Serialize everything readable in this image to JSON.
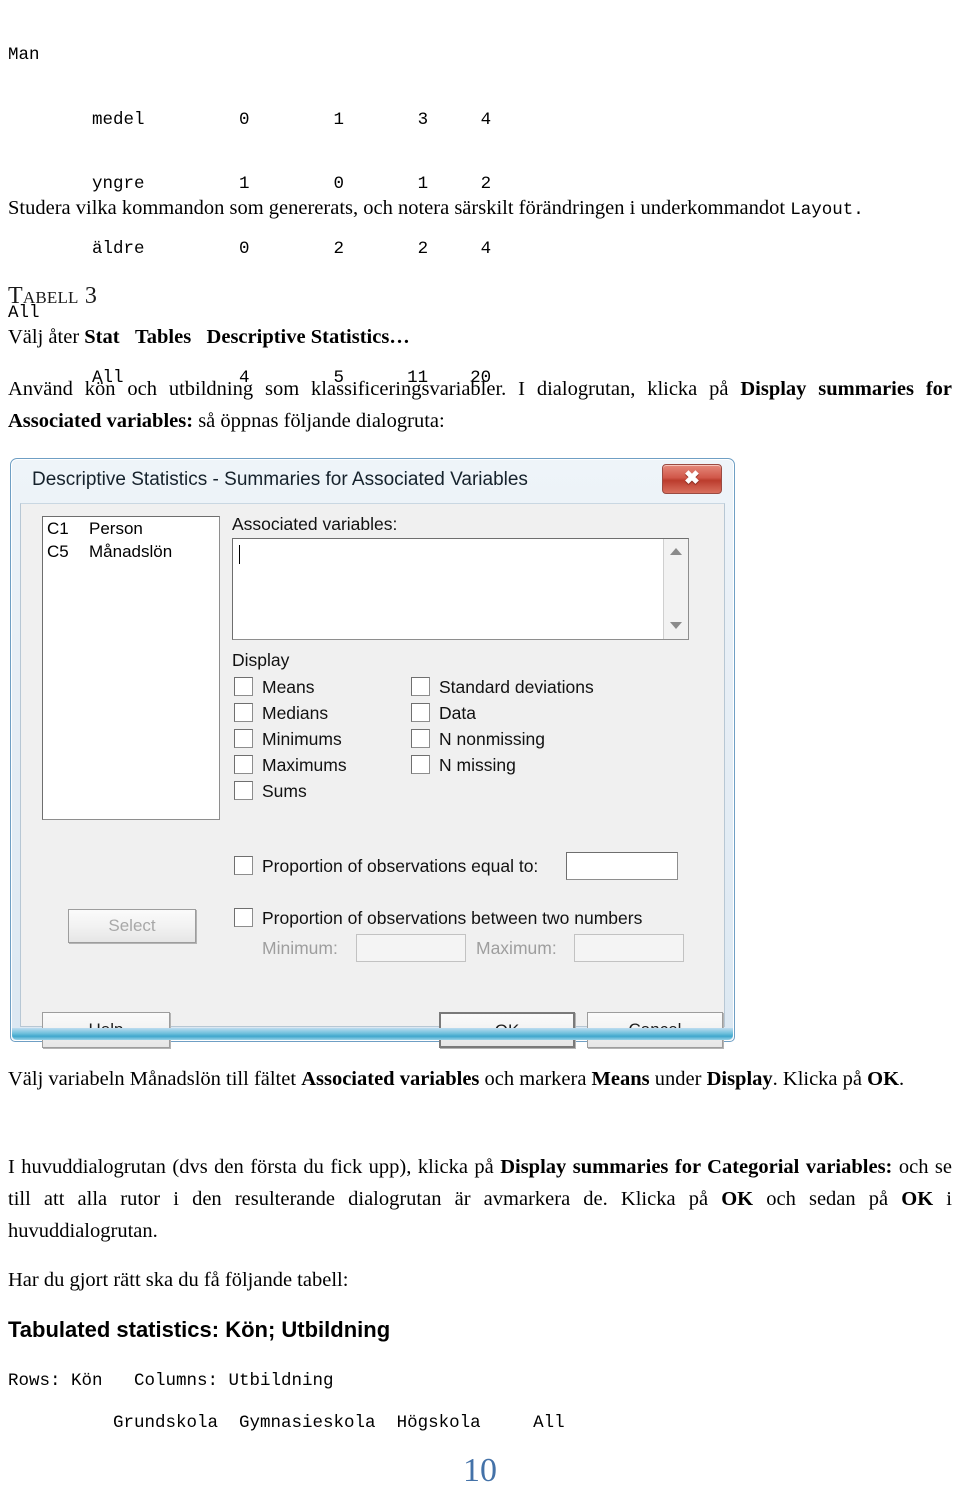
{
  "top_output": {
    "lines": [
      "Man",
      "        medel         0        1       3     4",
      "        yngre         1        0       1     2",
      "        äldre         0        2       2     4",
      "All",
      "        All           4        5      11    20"
    ]
  },
  "paragraphs": {
    "p1_a": "Studera vilka kommandon som genererats, och notera särskilt förändringen i underkommandot ",
    "p1_code": "Layout.",
    "tabell_heading_sc": "Tabell",
    "tabell_heading_num": " 3",
    "p2_a": "Välj åter ",
    "p2_b1": "Stat",
    "p2_b2": "Tables",
    "p2_b3": "Descriptive Statistics…",
    "p3_a": "Använd kön och utbildning som klassificeringsvariabler. I dialogrutan, klicka på ",
    "p3_b1": "Display summaries for Associated variables:",
    "p3_c": " så öppnas följande dialogruta:",
    "p4_a": "Välj variabeln Månadslön till fältet ",
    "p4_b1": "Associated variables",
    "p4_b": " och markera ",
    "p4_b2": "Means",
    "p4_c": " under ",
    "p4_b3": "Display",
    "p4_d": ". Klicka på ",
    "p4_b4": "OK",
    "p4_e": ".",
    "p5_a": "I huvuddialogrutan (dvs den första du fick upp), klicka på ",
    "p5_b1": "Display summaries for Categorial variables:",
    "p5_b": "  och se till att alla rutor i den resulterande dialogrutan är avmarkera de. Klicka på ",
    "p5_b2": "OK",
    "p5_c": " och sedan på ",
    "p5_b3": "OK",
    "p5_d": " i huvuddialogrutan.",
    "p6": "Har du gjort rätt ska du få följande tabell:"
  },
  "dialog": {
    "title": "Descriptive Statistics - Summaries for Associated Variables",
    "close_glyph": "✖",
    "variables": [
      {
        "code": "C1",
        "name": "Person"
      },
      {
        "code": "C5",
        "name": "Månadslön"
      }
    ],
    "select_button": "Select",
    "help_button": "Help",
    "ok_button": "OK",
    "cancel_button": "Cancel",
    "associated_label": "Associated variables:",
    "associated_value": "",
    "display_label": "Display",
    "checkboxes_left": [
      {
        "label": "Means",
        "checked": false
      },
      {
        "label": "Medians",
        "checked": false
      },
      {
        "label": "Minimums",
        "checked": false
      },
      {
        "label": "Maximums",
        "checked": false
      },
      {
        "label": "Sums",
        "checked": false
      }
    ],
    "checkboxes_right": [
      {
        "label": "Standard deviations",
        "checked": false
      },
      {
        "label": "Data",
        "checked": false
      },
      {
        "label": "N nonmissing",
        "checked": false
      },
      {
        "label": "N missing",
        "checked": false
      }
    ],
    "prop_equal_label": "Proportion of observations equal to:",
    "prop_equal_value": "",
    "prop_between_label": "Proportion of observations between two numbers",
    "minimum_label": "Minimum:",
    "minimum_value": "",
    "maximum_label": "Maximum:",
    "maximum_value": ""
  },
  "bottom_output": {
    "tabulated_heading": "Tabulated statistics: Kön; Utbildning",
    "rows_cols_line": "Rows: Kön   Columns: Utbildning",
    "column_header_line": "          Grundskola  Gymnasieskola  Högskola     All"
  },
  "footer": {
    "page_number": "10",
    "page_color": "#4472a8"
  }
}
